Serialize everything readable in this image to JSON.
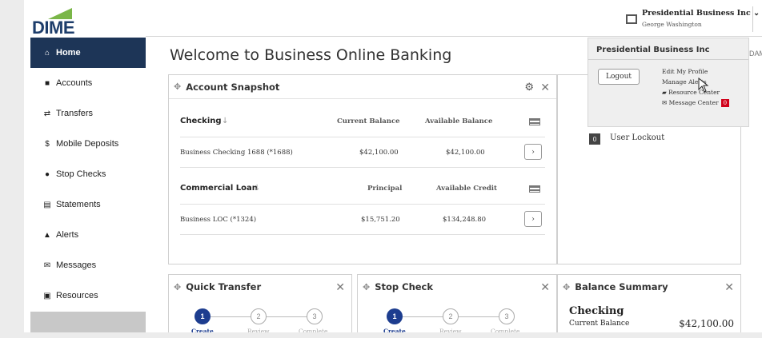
{
  "logo": {
    "text": "DIME"
  },
  "header": {
    "account_name": "Presidential Business Inc",
    "account_sub": "George Washington",
    "help_label": "?",
    "time_fragment": "DAM"
  },
  "sidebar": {
    "items": [
      {
        "label": "Home",
        "icon": "home-icon"
      },
      {
        "label": "Accounts",
        "icon": "folder-icon"
      },
      {
        "label": "Transfers",
        "icon": "transfer-icon"
      },
      {
        "label": "Mobile Deposits",
        "icon": "dollar-icon"
      },
      {
        "label": "Stop Checks",
        "icon": "stop-icon"
      },
      {
        "label": "Statements",
        "icon": "document-icon"
      },
      {
        "label": "Alerts",
        "icon": "bell-icon"
      },
      {
        "label": "Messages",
        "icon": "envelope-icon"
      },
      {
        "label": "Resources",
        "icon": "book-icon"
      }
    ]
  },
  "main": {
    "title": "Welcome to Business Online Banking"
  },
  "snapshot": {
    "title": "Account Snapshot",
    "checking": {
      "header": "Checking",
      "col1": "Current Balance",
      "col2": "Available Balance",
      "row": {
        "name": "Business Checking 1688 (*1688)",
        "v1": "$42,100.00",
        "v2": "$42,100.00"
      }
    },
    "loan": {
      "header": "Commercial Loan",
      "col1": "Principal",
      "col2": "Available Credit",
      "row": {
        "name": "Business LOC (*1324)",
        "v1": "$15,751.20",
        "v2": "$134,248.80"
      }
    }
  },
  "dropdown": {
    "title": "Presidential Business Inc",
    "logout": "Logout",
    "links": [
      "Edit My Profile",
      "Manage Alerts",
      "Resource Center",
      "Message Center"
    ],
    "message_badge": "0"
  },
  "alerts_panel": {
    "lockout_count": "0",
    "lockout_label": "User Lockout"
  },
  "quick_transfer": {
    "title": "Quick Transfer",
    "steps": [
      {
        "n": "1",
        "label": "Create"
      },
      {
        "n": "2",
        "label": "Review"
      },
      {
        "n": "3",
        "label": "Complete"
      }
    ]
  },
  "stop_check": {
    "title": "Stop Check",
    "steps": [
      {
        "n": "1",
        "label": "Create"
      },
      {
        "n": "2",
        "label": "Review"
      },
      {
        "n": "3",
        "label": "Complete"
      }
    ]
  },
  "balance_summary": {
    "title": "Balance Summary",
    "section": "Checking",
    "row_label": "Current Balance",
    "row_value": "$42,100.00"
  },
  "colors": {
    "nav_active": "#1d3557",
    "step_active": "#1d3d8f",
    "badge": "#d0021b"
  }
}
